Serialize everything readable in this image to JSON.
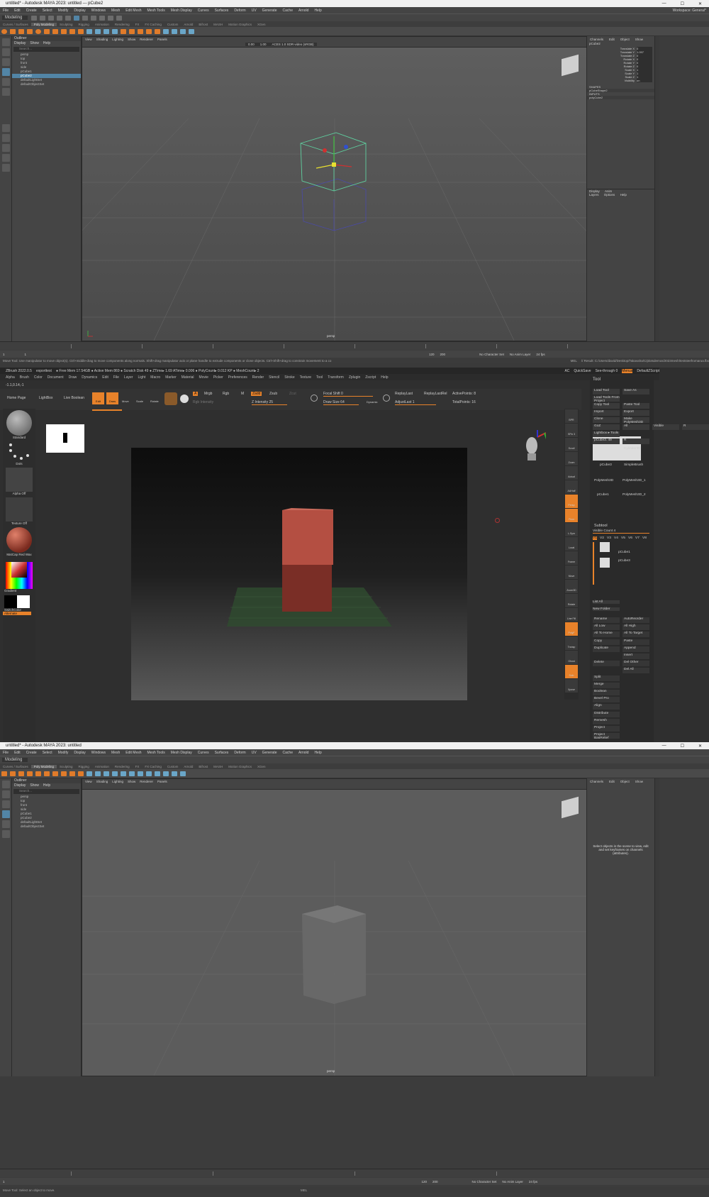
{
  "maya1": {
    "title": "untitled* - Autodesk MAYA 2023: untitled  ---  pCube2",
    "menus": [
      "File",
      "Edit",
      "Create",
      "Select",
      "Modify",
      "Display",
      "Windows",
      "Mesh",
      "Edit Mesh",
      "Mesh Tools",
      "Mesh Display",
      "Curves",
      "Surfaces",
      "Deform",
      "UV",
      "Generate",
      "Cache",
      "Arnold",
      "Help"
    ],
    "workspace": "Workspace: General*",
    "mode": "Modeling",
    "shelf_tabs": [
      "Curves / Surfaces",
      "Poly Modeling",
      "Sculpting",
      "Rigging",
      "Animation",
      "Rendering",
      "FX",
      "FX Caching",
      "Custom",
      "Arnold",
      "Bifrost",
      "MASH",
      "Motion Graphics",
      "XGen"
    ],
    "outliner_title": "Outliner",
    "outliner_menu": [
      "Display",
      "Show",
      "Help"
    ],
    "outliner_search": "Search...",
    "outliner_items": [
      "persp",
      "top",
      "front",
      "side",
      "pCube1",
      "pCube2",
      "defaultLightSet",
      "defaultObjectSet"
    ],
    "outliner_selected": 5,
    "viewport_menu": [
      "View",
      "Shading",
      "Lighting",
      "Show",
      "Renderer",
      "Panels"
    ],
    "viewport_fields": [
      "0.00",
      "1.00",
      "ACES 1.0 SDR-video (sRGB)"
    ],
    "camera": "persp",
    "channel_tabs": [
      "Channels",
      "Edit",
      "Object",
      "Show"
    ],
    "object_name": "pCube2",
    "attributes": [
      {
        "n": "Translate X",
        "v": "0"
      },
      {
        "n": "Translate Y",
        "v": "1.097"
      },
      {
        "n": "Translate Z",
        "v": "0"
      },
      {
        "n": "Rotate X",
        "v": "0"
      },
      {
        "n": "Rotate Y",
        "v": "0"
      },
      {
        "n": "Rotate Z",
        "v": "0"
      },
      {
        "n": "Scale X",
        "v": "1"
      },
      {
        "n": "Scale Y",
        "v": "1"
      },
      {
        "n": "Scale Z",
        "v": "1"
      },
      {
        "n": "Visibility",
        "v": "on"
      }
    ],
    "shapes_label": "SHAPES",
    "shapes": [
      "pCubeShape2"
    ],
    "inputs_label": "INPUTS",
    "inputs": [
      "polyCube2"
    ],
    "layer_tabs": [
      "Display",
      "Anim"
    ],
    "layer_menu": [
      "Layers",
      "Options",
      "Help"
    ],
    "range": [
      "1",
      "1",
      "120",
      "120",
      "200"
    ],
    "no_char": "No Character Set",
    "no_anim": "No Anim Layer",
    "fps": "24 fps",
    "mel": "MEL",
    "help": "Move Tool: Use manipulator to move object(s). Ctrl+middle-drag to move components along normals. Shift+drag manipulator axis or plane handle to extrude components or clone objects. Ctrl+Shift+drag to constrain movement to a co",
    "result": "// Result: C:/Users/david/Desktop/Takavaha/C/plotsdemos/2023mesh/teststeefromarua.fbx"
  },
  "zbrush": {
    "title": "ZBrush 2022.0.5",
    "file": "exporttest",
    "stats": "● Free Mem 17.54GB ● Active Mem 869 ● Scratch Disk 49 ● ZTime▸ 1.69 ATime▸ 0.006 ● PolyCount▸ 0.012 KP ● MeshCount▸ 2",
    "right_title": [
      "AC",
      "QuickSave",
      "See-through  0",
      "Menus",
      "DefaultZScript"
    ],
    "menus": [
      "Alpha",
      "Brush",
      "Color",
      "Document",
      "Draw",
      "Dynamics",
      "Edit",
      "File",
      "Layer",
      "Light",
      "Macro",
      "Marker",
      "Material",
      "Movie",
      "Picker",
      "Preferences",
      "Render",
      "Stencil",
      "Stroke",
      "Texture",
      "Tool",
      "Transform",
      "Zplugin",
      "Zscript",
      "Help"
    ],
    "coords": "-1.1,0.14,-1",
    "nav": [
      "Home Page",
      "LightBox",
      "Live Boolean"
    ],
    "modes": [
      "Edit",
      "Draw",
      "Move",
      "Scale",
      "Rotate"
    ],
    "mrgb": [
      "A",
      "Mrgb",
      "Rgb",
      "M",
      "Zadd",
      "Zsub",
      "Zcut"
    ],
    "rgb_intensity": "Rgb Intensity",
    "z_intensity": "Z Intensity 25",
    "focal": "Focal Shift 0",
    "draw_size": "Draw Size 64",
    "dynamic": "Dynamic",
    "replay": [
      "ReplayLast",
      "ReplayLastRel"
    ],
    "adjust": "AdjustLast 1",
    "points": [
      "ActivePoints: 8",
      "TotalPoints: 16"
    ],
    "left_labels": [
      "Standard",
      "Dots",
      "Alpha Off",
      "Texture Off",
      "MatCap Red Wax",
      "Gradient",
      "SwitchColor",
      "Alternate"
    ],
    "rshelf": [
      "BPR",
      "SPix 3",
      "Scroll",
      "Zoom",
      "Actual",
      "AAHalf",
      "Persp",
      "Floor",
      "L.Sym",
      "Local",
      "Frame",
      "Move",
      "Zoom3D",
      "Rotate",
      "Line Fill",
      "PolyF",
      "Transp",
      "Ghost",
      "Solo",
      "Xpose"
    ],
    "tool_title": "Tool",
    "tool_buttons": [
      [
        "Load Tool",
        "Save As"
      ],
      [
        "Load Tools From Project",
        ""
      ],
      [
        "Copy Tool",
        "Paste Tool"
      ],
      [
        "Import",
        "Export"
      ],
      [
        "Clone",
        "Make PolyMesh3D"
      ],
      [
        "GoZ",
        "All",
        "Visible",
        "R"
      ],
      [
        "Lightbox ▸ Tools",
        ""
      ],
      [
        "pCube3. 49",
        "R"
      ]
    ],
    "tools": [
      "pCube3",
      "Cylinder3D",
      "SimpleBrush",
      "PolyMesh3D",
      "PolyMesh3D_1",
      "pCube1",
      "pCube3",
      "PolyMesh3D_2"
    ],
    "subtool": "Subtool",
    "visible_count": "Visible Count 4",
    "versions": [
      "V1",
      "V2",
      "V3",
      "V4",
      "V5",
      "V6",
      "V7",
      "V8"
    ],
    "subtools": [
      "pCube1",
      "pCube3"
    ],
    "list_btns": [
      "List All",
      "New Folder"
    ],
    "ops": [
      [
        "Rename",
        "AutoReorder"
      ],
      [
        "All Low",
        "All High"
      ],
      [
        "All To Home",
        "All To Target"
      ],
      [
        "Copy",
        "Paste"
      ],
      [
        "Duplicate",
        "Append"
      ],
      [
        "",
        "Insert"
      ],
      [
        "Delete",
        "Del Other"
      ],
      [
        "",
        "Del All"
      ],
      [
        "Split",
        ""
      ],
      [
        "Merge",
        ""
      ],
      [
        "Boolean",
        ""
      ],
      [
        "Bevel Pro",
        ""
      ],
      [
        "Align",
        ""
      ],
      [
        "Distribute",
        ""
      ],
      [
        "Remesh",
        ""
      ],
      [
        "Project",
        ""
      ],
      [
        "Project BasRelief",
        ""
      ]
    ]
  },
  "maya2": {
    "title": "untitled* - Autodesk MAYA 2023: untitled",
    "outliner_items": [
      "persp",
      "top",
      "front",
      "side",
      "pCube1",
      "pCube2",
      "defaultLightSet",
      "defaultObjectSet"
    ],
    "channel_msg": "Select objects in the scene to view, edit and set keyframes on channels (attributes).",
    "help": "Move Tool: Select an object to move.",
    "camera": "persp"
  },
  "colors": {
    "maya_select": "#5285a6",
    "zb_orange": "#e8822a",
    "cube_red": "#9a3e33"
  }
}
